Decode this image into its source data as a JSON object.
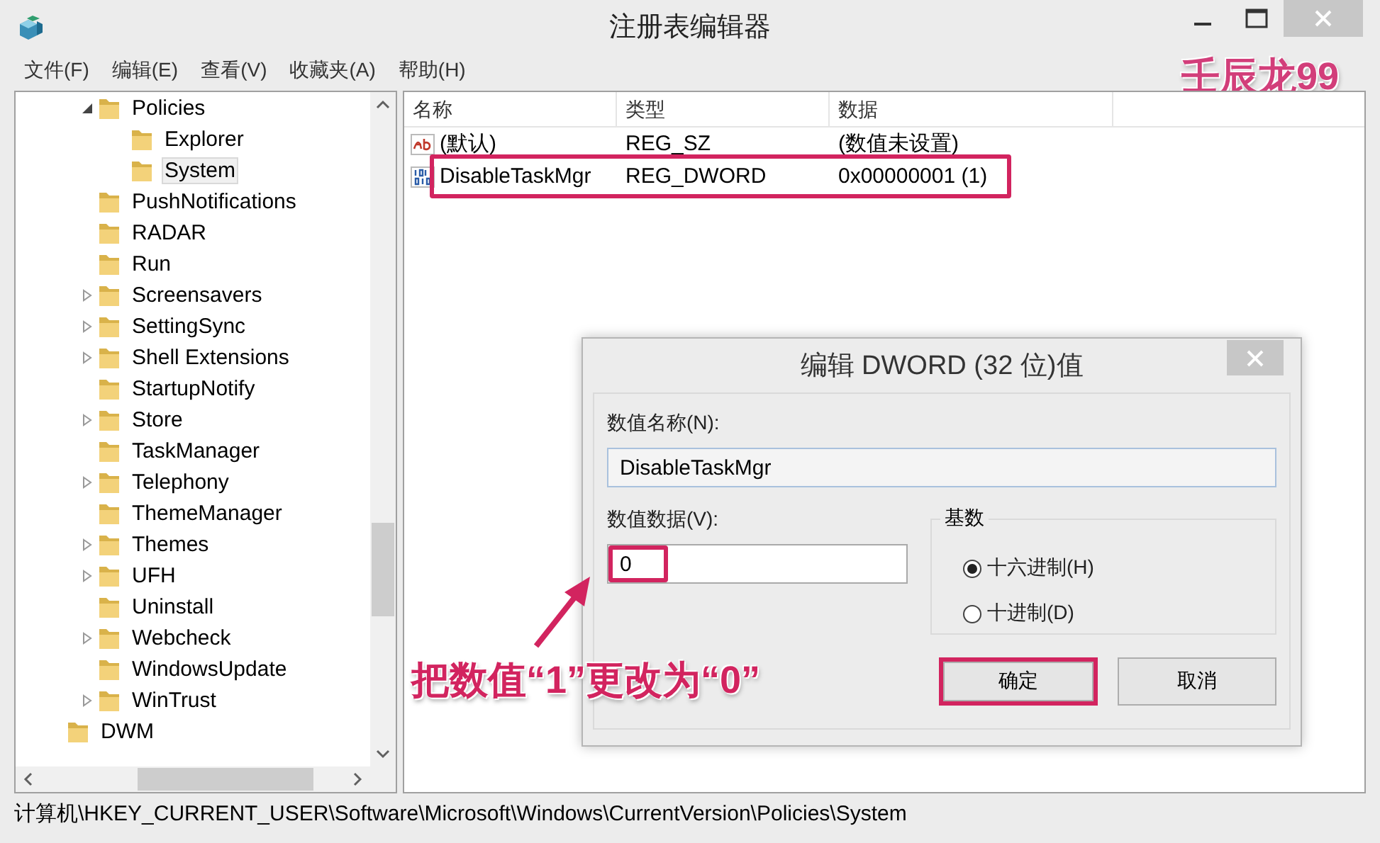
{
  "window": {
    "title": "注册表编辑器"
  },
  "menu": [
    "文件(F)",
    "编辑(E)",
    "查看(V)",
    "收藏夹(A)",
    "帮助(H)"
  ],
  "author_mark": "壬辰龙99",
  "tree": {
    "items": [
      {
        "label": "Policies",
        "has_children": true,
        "expanded": true,
        "selected": false,
        "children": [
          {
            "label": "Explorer",
            "has_children": false,
            "expanded": false,
            "selected": false
          },
          {
            "label": "System",
            "has_children": false,
            "expanded": false,
            "selected": true
          }
        ]
      },
      {
        "label": "PushNotifications",
        "has_children": false,
        "expanded": false,
        "selected": false
      },
      {
        "label": "RADAR",
        "has_children": false,
        "expanded": false,
        "selected": false
      },
      {
        "label": "Run",
        "has_children": false,
        "expanded": false,
        "selected": false
      },
      {
        "label": "Screensavers",
        "has_children": true,
        "expanded": false,
        "selected": false
      },
      {
        "label": "SettingSync",
        "has_children": true,
        "expanded": false,
        "selected": false
      },
      {
        "label": "Shell Extensions",
        "has_children": true,
        "expanded": false,
        "selected": false
      },
      {
        "label": "StartupNotify",
        "has_children": false,
        "expanded": false,
        "selected": false
      },
      {
        "label": "Store",
        "has_children": true,
        "expanded": false,
        "selected": false
      },
      {
        "label": "TaskManager",
        "has_children": false,
        "expanded": false,
        "selected": false
      },
      {
        "label": "Telephony",
        "has_children": true,
        "expanded": false,
        "selected": false
      },
      {
        "label": "ThemeManager",
        "has_children": false,
        "expanded": false,
        "selected": false
      },
      {
        "label": "Themes",
        "has_children": true,
        "expanded": false,
        "selected": false
      },
      {
        "label": "UFH",
        "has_children": true,
        "expanded": false,
        "selected": false
      },
      {
        "label": "Uninstall",
        "has_children": false,
        "expanded": false,
        "selected": false
      },
      {
        "label": "Webcheck",
        "has_children": true,
        "expanded": false,
        "selected": false
      },
      {
        "label": "WindowsUpdate",
        "has_children": false,
        "expanded": false,
        "selected": false
      },
      {
        "label": "WinTrust",
        "has_children": true,
        "expanded": false,
        "selected": false
      }
    ],
    "outer_items": [
      {
        "label": "DWM",
        "has_children": false,
        "expanded": false,
        "selected": false
      }
    ]
  },
  "list": {
    "columns": [
      "名称",
      "类型",
      "数据"
    ],
    "rows": [
      {
        "kind": "string",
        "name": "(默认)",
        "type": "REG_SZ",
        "data": "(数值未设置)",
        "highlighted": false
      },
      {
        "kind": "binary",
        "name": "DisableTaskMgr",
        "type": "REG_DWORD",
        "data": "0x00000001 (1)",
        "highlighted": true
      }
    ]
  },
  "status_bar": "计算机\\HKEY_CURRENT_USER\\Software\\Microsoft\\Windows\\CurrentVersion\\Policies\\System",
  "dialog": {
    "title": "编辑 DWORD (32 位)值",
    "name_label": "数值名称(N):",
    "name_value": "DisableTaskMgr",
    "data_label": "数值数据(V):",
    "data_value": "0",
    "data_highlighted": true,
    "base_label": "基数",
    "bases": [
      {
        "label": "十六进制(H)",
        "selected": true
      },
      {
        "label": "十进制(D)",
        "selected": false
      }
    ],
    "buttons": [
      {
        "label": "确定",
        "highlighted": true
      },
      {
        "label": "取消",
        "highlighted": false
      }
    ]
  },
  "annotation": {
    "caption": "把数值“1”更改为“0”"
  }
}
